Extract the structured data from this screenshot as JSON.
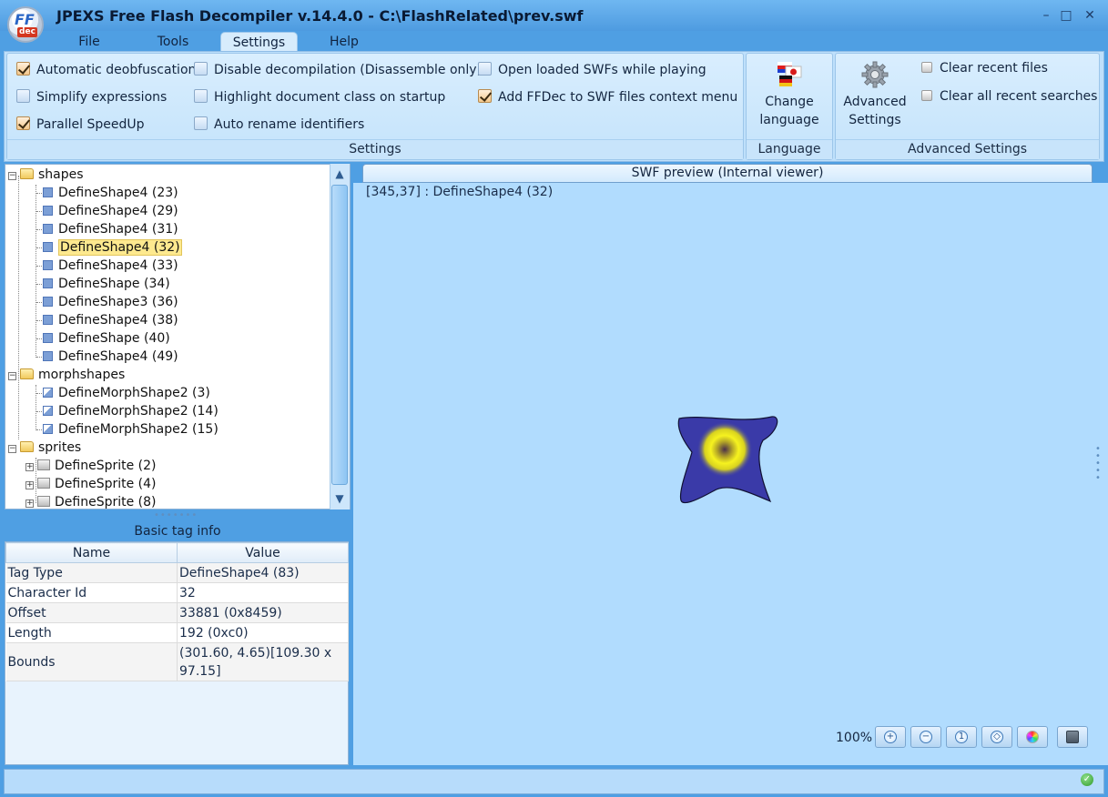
{
  "window": {
    "title": "JPEXS Free Flash Decompiler v.14.4.0 - C:\\FlashRelated\\prev.swf",
    "logo_top": "FF",
    "logo_bottom": "dec",
    "minimize": "–",
    "maximize": "□",
    "close": "✕"
  },
  "menu": {
    "tabs": [
      "File",
      "Tools",
      "Settings",
      "Help"
    ],
    "active": "Settings"
  },
  "ribbon": {
    "settings_group": {
      "label": "Settings",
      "options": [
        {
          "label": "Automatic deobfuscation",
          "checked": true
        },
        {
          "label": "Simplify expressions",
          "checked": false
        },
        {
          "label": "Parallel SpeedUp",
          "checked": true
        },
        {
          "label": "Disable decompilation (Disassemble only)",
          "checked": false
        },
        {
          "label": "Highlight document class on startup",
          "checked": false
        },
        {
          "label": "Auto rename identifiers",
          "checked": false
        },
        {
          "label": "Open loaded SWFs while playing",
          "checked": false
        },
        {
          "label": "Add FFDec to SWF files context menu",
          "checked": true
        }
      ]
    },
    "language_group": {
      "label": "Language",
      "button_line1": "Change",
      "button_line2": "language",
      "icon": "flags-icon"
    },
    "advanced_group": {
      "label": "Advanced Settings",
      "button_line1": "Advanced",
      "button_line2": "Settings",
      "icon": "gear-icon",
      "clear_recent_files": "Clear recent files",
      "clear_recent_searches": "Clear all recent searches"
    }
  },
  "tree": {
    "folders": [
      {
        "label": "shapes",
        "items": [
          "DefineShape4 (23)",
          "DefineShape4 (29)",
          "DefineShape4 (31)",
          "DefineShape4 (32)",
          "DefineShape4 (33)",
          "DefineShape (34)",
          "DefineShape3 (36)",
          "DefineShape4 (38)",
          "DefineShape (40)",
          "DefineShape4 (49)"
        ]
      },
      {
        "label": "morphshapes",
        "items": [
          "DefineMorphShape2 (3)",
          "DefineMorphShape2 (14)",
          "DefineMorphShape2 (15)"
        ]
      },
      {
        "label": "sprites",
        "items": [
          "DefineSprite (2)",
          "DefineSprite (4)",
          "DefineSprite (8)"
        ]
      }
    ],
    "selected": "DefineShape4 (32)"
  },
  "tag_info": {
    "title": "Basic tag info",
    "headers": [
      "Name",
      "Value"
    ],
    "rows": [
      {
        "name": "Tag Type",
        "value": "DefineShape4 (83)"
      },
      {
        "name": "Character Id",
        "value": "32"
      },
      {
        "name": "Offset",
        "value": "33881 (0x8459)"
      },
      {
        "name": "Length",
        "value": "192 (0xc0)"
      },
      {
        "name": "Bounds",
        "value": "(301.60, 4.65)[109.30 x 97.15]"
      }
    ]
  },
  "preview": {
    "header": "SWF preview (Internal viewer)",
    "coordinates": "[345,37] : DefineShape4 (32)",
    "zoom": "100%",
    "zoom_buttons": [
      "zoom-in-icon",
      "zoom-out-icon",
      "zoom-actual-icon",
      "zoom-fit-icon",
      "color-wheel-icon",
      "camera-icon"
    ]
  },
  "colors": {
    "shape_fill": "#3a3aa8",
    "gradient_center": "#4a2f4a",
    "gradient_ring": "#f6f21f",
    "preview_bg": "#b1dcfe"
  }
}
